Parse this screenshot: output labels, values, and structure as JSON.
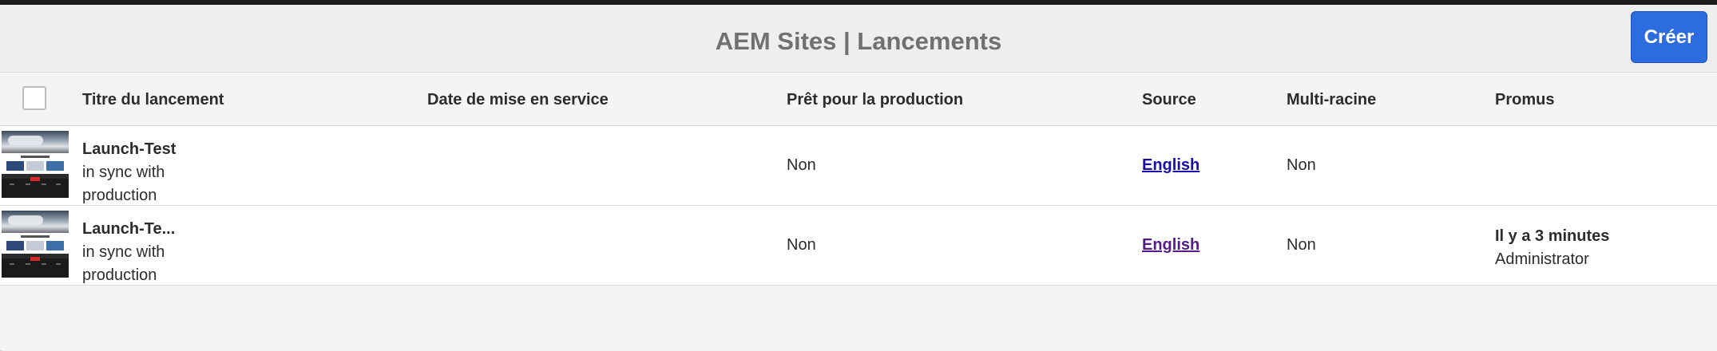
{
  "header": {
    "title": "AEM Sites | Lancements",
    "create_label": "Créer"
  },
  "table": {
    "columns": [
      "Titre du lancement",
      "Date de mise en service",
      "Prêt pour la production",
      "Source",
      "Multi-racine",
      "Promus"
    ],
    "rows": [
      {
        "title": "Launch-Test",
        "status": "in sync with production",
        "live_date": "",
        "ready_for_production": "Non",
        "source": "English",
        "multi_root": "Non",
        "promoted_when": "",
        "promoted_by": ""
      },
      {
        "title": "Launch-Te...",
        "status": "in sync with production",
        "live_date": "",
        "ready_for_production": "Non",
        "source": "English",
        "multi_root": "Non",
        "promoted_when": "Il y a 3 minutes",
        "promoted_by": "Administrator"
      }
    ]
  },
  "colors": {
    "accent": "#2d6cdf",
    "link": "#1a0dab",
    "link_visited": "#551a8b"
  }
}
